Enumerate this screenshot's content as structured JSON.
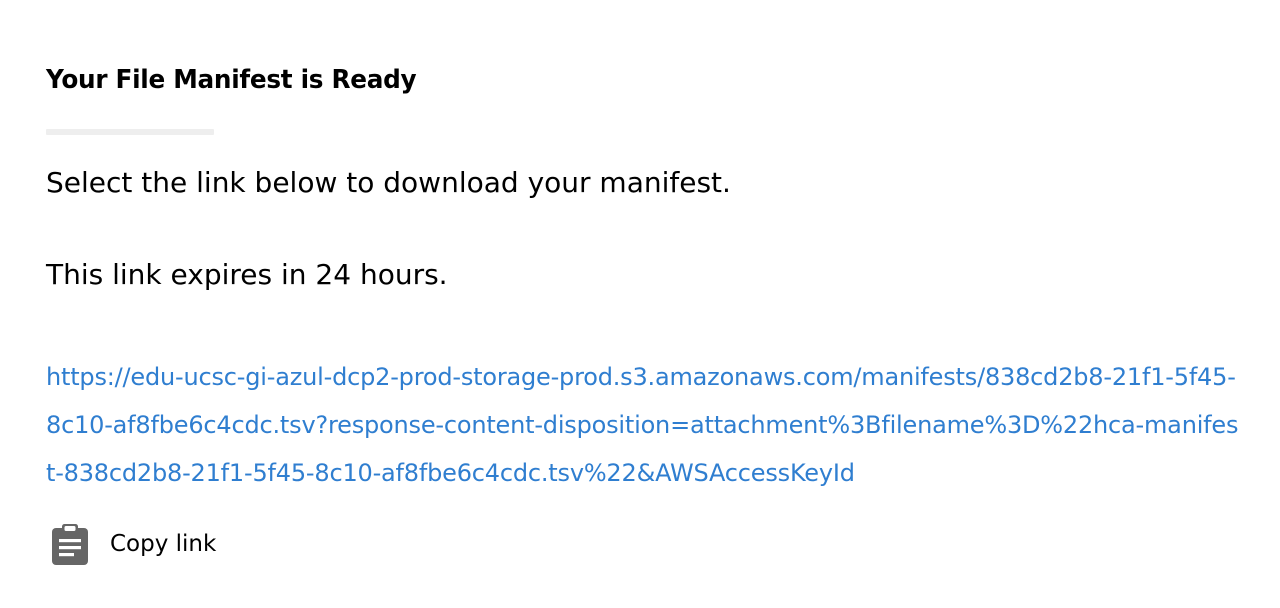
{
  "dialog": {
    "title": "Your File Manifest is Ready",
    "paragraphs": [
      "Select the link below to download your manifest.",
      "This link expires in 24 hours."
    ],
    "link": {
      "text": "https://edu-ucsc-gi-azul-dcp2-prod-storage-prod.s3.amazonaws.com/manifests/838cd2b8-21f1-5f45-8c10-af8fbe6c4cdc.tsv?response-content-disposition=attachment%3Bfilename%3D%22hca-manifest-838cd2b8-21f1-5f45-8c10-af8fbe6c4cdc.tsv%22&AWSAccessKeyId",
      "color": "#2f7ed0"
    },
    "copy_button": {
      "label": "Copy link",
      "icon": "clipboard-icon",
      "icon_color": "#666666"
    }
  }
}
